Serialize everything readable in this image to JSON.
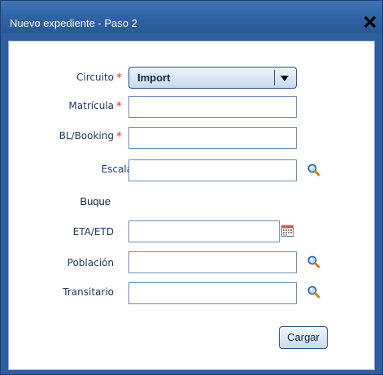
{
  "window": {
    "title": "Nuevo expediente - Paso 2",
    "close_icon": "close-icon"
  },
  "form": {
    "required_marker": "*",
    "circuito": {
      "label": "Circuito",
      "required": true,
      "selected": "Import"
    },
    "matricula": {
      "label": "Matrícula",
      "required": true,
      "value": ""
    },
    "bl_booking": {
      "label": "BL/Booking",
      "required": true,
      "value": ""
    },
    "escala": {
      "label": "Escala",
      "value": "",
      "icon": "search-icon"
    },
    "buque": {
      "label": "Buque"
    },
    "eta_etd": {
      "label": "ETA/ETD",
      "value": "",
      "icon": "calendar-icon"
    },
    "poblacion": {
      "label": "Población",
      "value": "",
      "icon": "search-icon"
    },
    "transitario": {
      "label": "Transitario",
      "value": "",
      "icon": "search-icon"
    }
  },
  "buttons": {
    "cargar": "Cargar"
  },
  "colors": {
    "titlebar": "#2f62a2",
    "label": "#1e3a64",
    "required": "#e03131",
    "input_border": "#6e8bb3"
  }
}
